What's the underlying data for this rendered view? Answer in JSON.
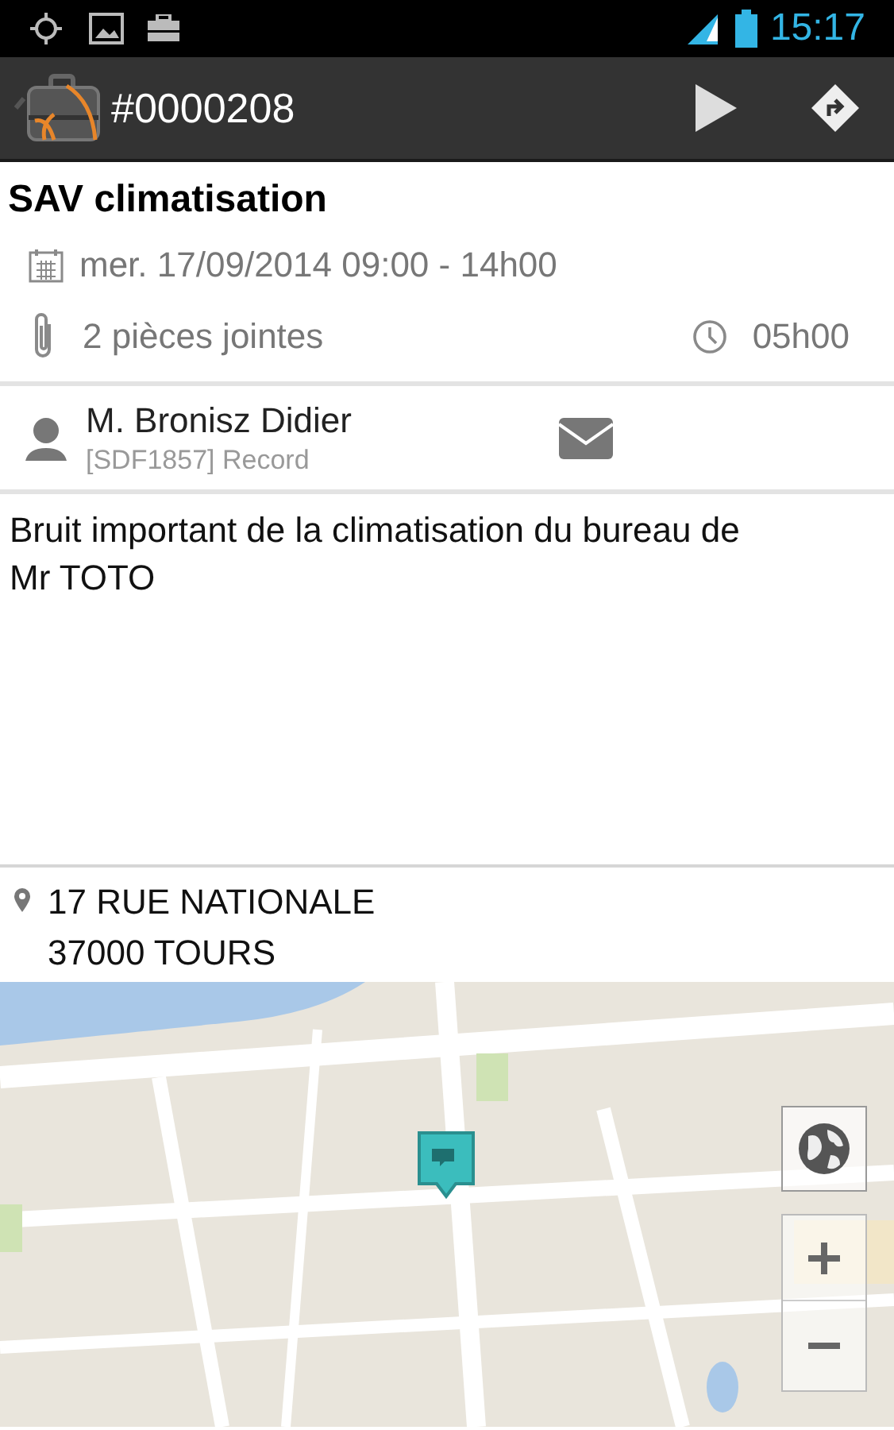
{
  "status_bar": {
    "time": "15:17"
  },
  "action_bar": {
    "title": "#0000208"
  },
  "job": {
    "title": "SAV climatisation",
    "date": "mer. 17/09/2014 09:00 - 14h00",
    "attachments": "2 pièces jointes",
    "duration": "05h00"
  },
  "contact": {
    "name": "M. Bronisz Didier",
    "company": "[SDF1857] Record"
  },
  "description": "Bruit important de la climatisation du bureau de Mr TOTO",
  "address": {
    "street": "17 RUE NATIONALE",
    "city": "37000 TOURS"
  }
}
